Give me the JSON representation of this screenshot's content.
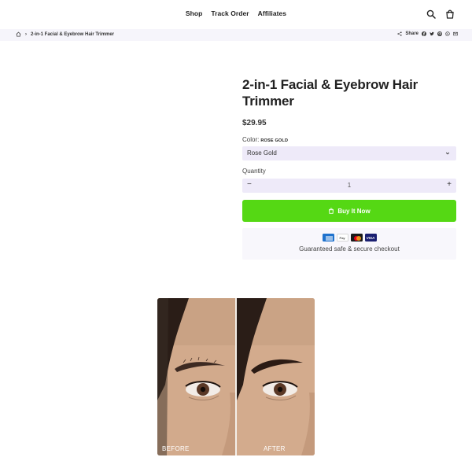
{
  "header": {
    "nav": [
      "Shop",
      "Track Order",
      "Affiliates"
    ],
    "icons": [
      "search-icon",
      "cart-icon"
    ]
  },
  "breadcrumb": {
    "home_icon": "home-icon",
    "separator": "›",
    "current": "2-in-1 Facial & Eyebrow Hair Trimmer"
  },
  "share": {
    "label": "Share",
    "icons": [
      "facebook-icon",
      "twitter-icon",
      "pinterest-icon",
      "whatsapp-icon",
      "email-icon"
    ]
  },
  "product": {
    "title": "2-in-1 Facial & Eyebrow Hair Trimmer",
    "price": "$29.95",
    "color_label": "Color:",
    "color_value": "ROSE GOLD",
    "select_value": "Rose Gold",
    "quantity_label": "Quantity",
    "quantity_minus": "−",
    "quantity_value": "1",
    "quantity_plus": "+",
    "buy_label": "Buy It Now",
    "secure_text": "Guaranteed safe & secure checkout",
    "payment_methods": [
      "American Express",
      "Apple Pay",
      "Mastercard",
      "Visa"
    ],
    "apple_pay_text": "Pay",
    "visa_text": "VISA"
  },
  "image": {
    "before_label": "BEFORE",
    "after_label": "AFTER"
  },
  "colors": {
    "accent_green": "#55d814",
    "field_bg": "#eeeaf9",
    "crumb_bg": "#f6f5fb"
  }
}
